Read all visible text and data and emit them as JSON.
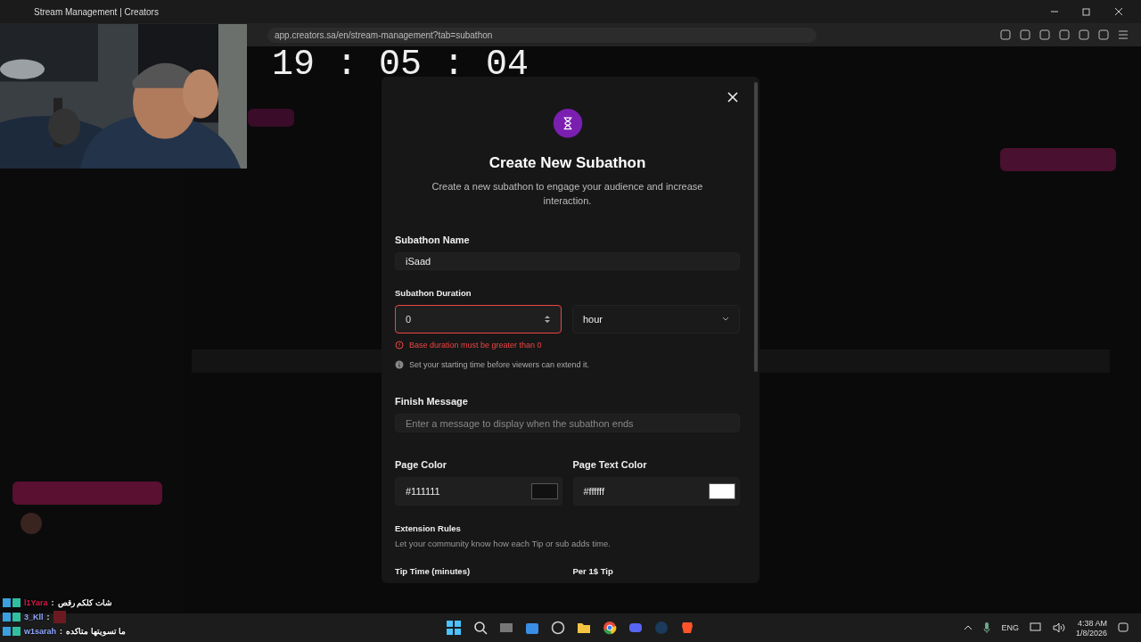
{
  "browser": {
    "tab_title": "Stream Management | Creators",
    "url": "app.creators.sa/en/stream-management?tab=subathon"
  },
  "overlay": {
    "clock": "19 : 05 : 04",
    "chat": [
      {
        "name": "l1Yara",
        "color": "#d81b4a",
        "separator": ":",
        "message": "شات كلكم رقص"
      },
      {
        "name": "3_Kll",
        "color": "#8fa8ff",
        "separator": ":"
      },
      {
        "name": "w1sarah",
        "color": "#8fa8ff",
        "separator": ":",
        "message": "ما تسويتها متاكده"
      }
    ]
  },
  "dialog": {
    "title": "Create New Subathon",
    "description": "Create a new subathon to engage your audience and increase interaction.",
    "name_field": {
      "label": "Subathon Name",
      "value": "iSaad"
    },
    "duration": {
      "label": "Subathon Duration",
      "value": "0",
      "invalid": true,
      "unit": "hour",
      "error": "Base duration must be greater than 0",
      "hint": "Set your starting time before viewers can extend it."
    },
    "finish_message": {
      "label": "Finish Message",
      "placeholder": "Enter a message to display when the subathon ends"
    },
    "colors": [
      {
        "label": "Page Color",
        "value": "#111111"
      },
      {
        "label": "Page Text Color",
        "value": "#ffffff"
      }
    ],
    "extension_rules": {
      "title": "Extension Rules",
      "description": "Let your community know how each Tip or sub adds time.",
      "columns": [
        "Tip Time (minutes)",
        "Per 1$ Tip"
      ]
    }
  },
  "taskbar": {
    "language": "ENG",
    "time": "4:38 AM",
    "date": "1/8/2026"
  }
}
